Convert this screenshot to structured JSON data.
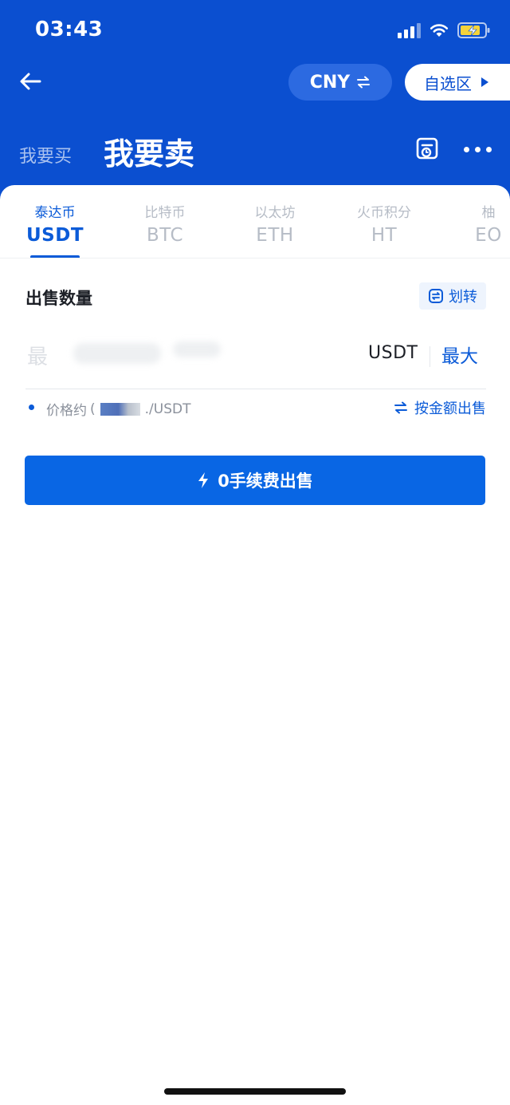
{
  "status_bar": {
    "time": "03:43",
    "icons": [
      "signal-icon",
      "wifi-icon",
      "battery-charging-icon"
    ]
  },
  "header": {
    "currency_label": "CNY",
    "watchlist_label": "自选区",
    "tab_buy": "我要买",
    "tab_sell": "我要卖"
  },
  "coin_tabs": [
    {
      "cn": "泰达币",
      "symbol": "USDT",
      "active": true
    },
    {
      "cn": "比特币",
      "symbol": "BTC",
      "active": false
    },
    {
      "cn": "以太坊",
      "symbol": "ETH",
      "active": false
    },
    {
      "cn": "火币积分",
      "symbol": "HT",
      "active": false
    },
    {
      "cn": "柚",
      "symbol": "EO",
      "active": false
    }
  ],
  "form": {
    "section_title": "出售数量",
    "transfer_label": "划转",
    "amount_placeholder": "最",
    "unit": "USDT",
    "max_label": "最大",
    "price_prefix": "价格约",
    "price_paren": "(",
    "price_suffix": "./USDT",
    "by_amount_label": "按金额出售",
    "sell_button_label": "0手续费出售"
  },
  "colors": {
    "header_blue": "#0b4fd0",
    "accent_blue": "#0b5bd8",
    "button_blue": "#0966e4"
  }
}
